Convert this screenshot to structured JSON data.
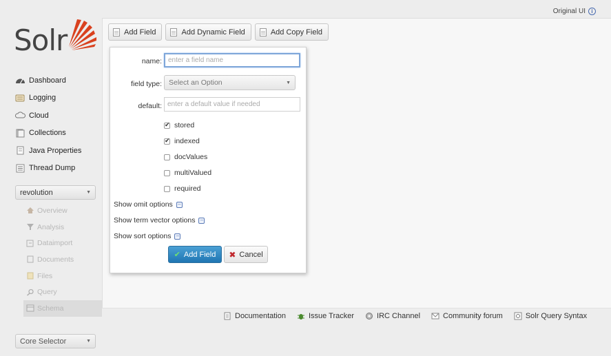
{
  "header": {
    "original_ui": "Original UI"
  },
  "logo": {
    "text": "Solr"
  },
  "nav": [
    {
      "label": "Dashboard",
      "icon": "dashboard-icon"
    },
    {
      "label": "Logging",
      "icon": "logging-icon"
    },
    {
      "label": "Cloud",
      "icon": "cloud-icon"
    },
    {
      "label": "Collections",
      "icon": "collections-icon"
    },
    {
      "label": "Java Properties",
      "icon": "java-icon"
    },
    {
      "label": "Thread Dump",
      "icon": "thread-dump-icon"
    }
  ],
  "core": {
    "selected": "revolution"
  },
  "subnav": [
    {
      "label": "Overview"
    },
    {
      "label": "Analysis"
    },
    {
      "label": "Dataimport"
    },
    {
      "label": "Documents"
    },
    {
      "label": "Files"
    },
    {
      "label": "Query"
    },
    {
      "label": "Schema"
    }
  ],
  "core_selector": {
    "label": "Core Selector"
  },
  "toolbar": {
    "add_field": "Add Field",
    "add_dynamic_field": "Add Dynamic Field",
    "add_copy_field": "Add Copy Field"
  },
  "form": {
    "name_label": "name:",
    "name_placeholder": "enter a field name",
    "type_label": "field type:",
    "type_value": "Select an Option",
    "default_label": "default:",
    "default_placeholder": "enter a default value if needed",
    "checkboxes": [
      {
        "label": "stored",
        "checked": true
      },
      {
        "label": "indexed",
        "checked": true
      },
      {
        "label": "docValues",
        "checked": false
      },
      {
        "label": "multiValued",
        "checked": false
      },
      {
        "label": "required",
        "checked": false
      }
    ],
    "show_omit": "Show omit options",
    "show_term_vector": "Show term vector options",
    "show_sort": "Show sort options",
    "submit": "Add Field",
    "cancel": "Cancel"
  },
  "footer": [
    {
      "label": "Documentation",
      "icon": "document-icon"
    },
    {
      "label": "Issue Tracker",
      "icon": "bug-icon"
    },
    {
      "label": "IRC Channel",
      "icon": "irc-icon"
    },
    {
      "label": "Community forum",
      "icon": "mail-icon"
    },
    {
      "label": "Solr Query Syntax",
      "icon": "query-syntax-icon"
    }
  ],
  "colors": {
    "accent": "#1f76b3",
    "logo_red": "#d9411e"
  }
}
